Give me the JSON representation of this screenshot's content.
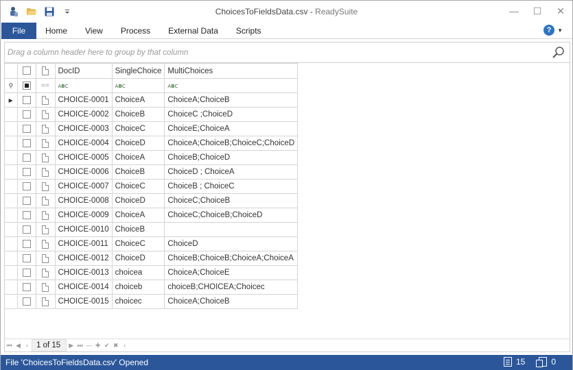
{
  "window": {
    "title_file": "ChoicesToFieldsData.csv",
    "title_sep": " - ",
    "title_app": "ReadySuite"
  },
  "quick_access": {
    "icons": [
      "app-icon",
      "open-folder-icon",
      "save-icon",
      "customize-dropdown-icon"
    ]
  },
  "window_controls": {
    "minimize": "—",
    "maximize": "☐",
    "close": "✕"
  },
  "ribbon": {
    "file_label": "File",
    "tabs": [
      "Home",
      "View",
      "Process",
      "External Data",
      "Scripts"
    ],
    "help_label": "?"
  },
  "group_panel": {
    "hint": "Drag a column header here to group by that column"
  },
  "grid": {
    "columns": [
      "DocID",
      "SingleChoice",
      "MultiChoices"
    ],
    "filter_type_label": "ABC",
    "rows": [
      {
        "docid": "CHOICE-0001",
        "single": "ChoiceA",
        "multi": "ChoiceA;ChoiceB"
      },
      {
        "docid": "CHOICE-0002",
        "single": "ChoiceB",
        "multi": "ChoiceC ;ChoiceD"
      },
      {
        "docid": "CHOICE-0003",
        "single": "ChoiceC",
        "multi": "ChoiceE;ChoiceA"
      },
      {
        "docid": "CHOICE-0004",
        "single": "ChoiceD",
        "multi": "ChoiceA;ChoiceB;ChoiceC;ChoiceD"
      },
      {
        "docid": "CHOICE-0005",
        "single": "ChoiceA",
        "multi": "ChoiceB;ChoiceD"
      },
      {
        "docid": "CHOICE-0006",
        "single": "ChoiceB",
        "multi": "ChoiceD ; ChoiceA"
      },
      {
        "docid": "CHOICE-0007",
        "single": "ChoiceC",
        "multi": "ChoiceB ; ChoiceC"
      },
      {
        "docid": "CHOICE-0008",
        "single": "ChoiceD",
        "multi": "ChoiceC;ChoiceB"
      },
      {
        "docid": "CHOICE-0009",
        "single": "ChoiceA",
        "multi": "ChoiceC;ChoiceB;ChoiceD"
      },
      {
        "docid": "CHOICE-0010",
        "single": "ChoiceB",
        "multi": ""
      },
      {
        "docid": "CHOICE-0011",
        "single": "ChoiceC",
        "multi": "ChoiceD"
      },
      {
        "docid": "CHOICE-0012",
        "single": "ChoiceD",
        "multi": "ChoiceB;ChoiceB;ChoiceA;ChoiceA"
      },
      {
        "docid": "CHOICE-0013",
        "single": "choicea",
        "multi": "ChoiceA;ChoiceE"
      },
      {
        "docid": "CHOICE-0014",
        "single": "choiceb",
        "multi": "choiceB;CHOICEA;Choicec"
      },
      {
        "docid": "CHOICE-0015",
        "single": "choicec",
        "multi": "ChoiceA;ChoiceB"
      }
    ]
  },
  "pager": {
    "page_text": "1 of 15"
  },
  "status": {
    "message": "File 'ChoicesToFieldsData.csv' Opened",
    "doc_count": "15",
    "selected_count": "0"
  },
  "colors": {
    "accent": "#2b579a",
    "help_blue": "#2b74c4",
    "grid_line": "#d4d4d4"
  }
}
